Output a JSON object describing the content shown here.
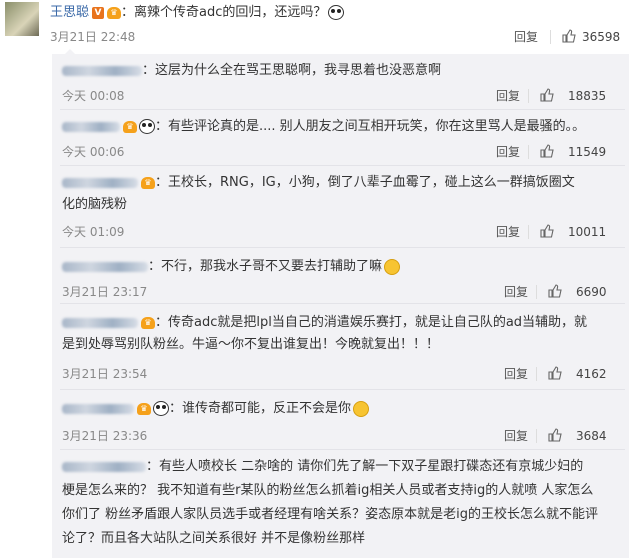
{
  "main": {
    "username": "王思聪",
    "text": "：离辣个传奇adc的回归，还远吗？",
    "time": "3月21日 22:48",
    "reply_label": "回复",
    "likes": "36598"
  },
  "replies": [
    {
      "text": "：这层为什么全在骂王思聪啊，我寻思着也没恶意啊",
      "time": "今天 00:08",
      "reply_label": "回复",
      "likes": "18835"
    },
    {
      "text": "：有些评论真的是.... 别人朋友之间互相开玩笑，你在这里骂人是最骚的。。",
      "time": "今天 00:06",
      "reply_label": "回复",
      "likes": "11549"
    },
    {
      "text1": "：王校长，RNG，IG，小狗，倒了八辈子血霉了，碰上这么一群搞饭圈文",
      "text2": "化的脑残粉",
      "time": "今天 01:09",
      "reply_label": "回复",
      "likes": "10011"
    },
    {
      "text": "：不行，那我水子哥不又要去打辅助了嘛",
      "time": "3月21日 23:17",
      "reply_label": "回复",
      "likes": "6690"
    },
    {
      "text1": "：传奇adc就是把lpl当自己的消遣娱乐赛打，就是让自己队的ad当辅助，就",
      "text2": "是到处辱骂别队粉丝。牛逼～你不复出谁复出！今晚就复出！！！",
      "time": "3月21日 23:54",
      "reply_label": "回复",
      "likes": "4162"
    },
    {
      "text": "：谁传奇都可能，反正不会是你",
      "time": "3月21日 23:36",
      "reply_label": "回复",
      "likes": "3684"
    },
    {
      "text1": "：有些人喷校长 二杂啥的 请你们先了解一下双子星跟打碟态还有京城少妇的",
      "text2": "梗是怎么来的？ 我不知道有些r某队的粉丝怎么抓着ig相关人员或者支持ig的人就喷 人家怎么",
      "text3": "你们了 粉丝矛盾跟人家队员选手或者经理有啥关系？姿态原本就是老ig的王校长怎么就不能评",
      "text4": "论了？而且各大站队之间关系很好 并不是像粉丝那样"
    }
  ],
  "colors": {
    "username": "#3b6aa8",
    "badge": "#e8731c",
    "sub_bg": "#f2f2f5"
  },
  "icons": [
    "thumb-up-icon",
    "verified-v-icon",
    "medal-icon",
    "panda-emoji-icon",
    "smile-emoji-icon"
  ]
}
